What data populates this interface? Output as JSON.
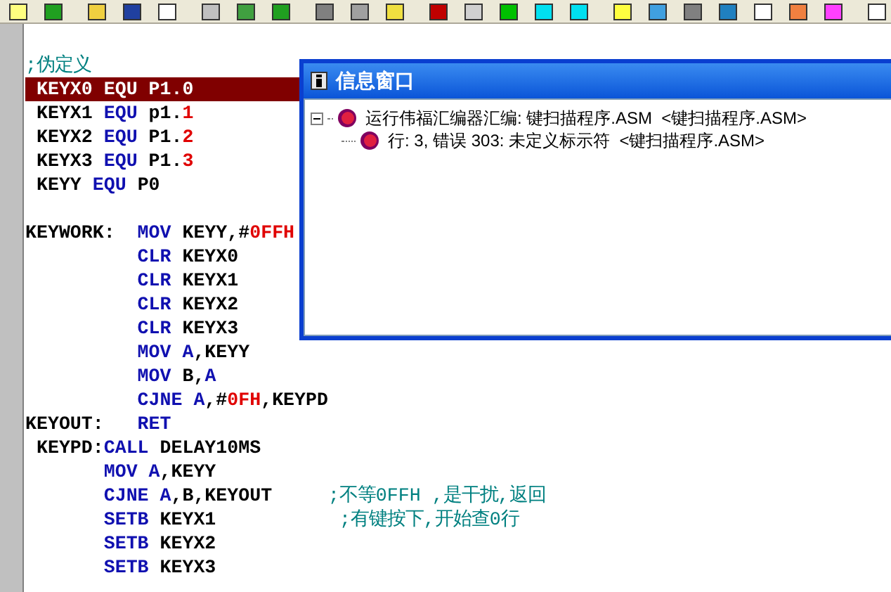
{
  "editor": {
    "lines": [
      {
        "error": false,
        "segments": [
          {
            "kind": "comment",
            "text": ";伪定义"
          }
        ]
      },
      {
        "error": true,
        "segments": [
          {
            "kind": "plain",
            "text": " KEYX0 EQU P1.0"
          }
        ]
      },
      {
        "error": false,
        "segments": [
          {
            "kind": "plain",
            "text": " KEYX1 "
          },
          {
            "kind": "keyword",
            "text": "EQU"
          },
          {
            "kind": "plain",
            "text": " p1."
          },
          {
            "kind": "number",
            "text": "1"
          }
        ]
      },
      {
        "error": false,
        "segments": [
          {
            "kind": "plain",
            "text": " KEYX2 "
          },
          {
            "kind": "keyword",
            "text": "EQU"
          },
          {
            "kind": "plain",
            "text": " P1."
          },
          {
            "kind": "number",
            "text": "2"
          }
        ]
      },
      {
        "error": false,
        "segments": [
          {
            "kind": "plain",
            "text": " KEYX3 "
          },
          {
            "kind": "keyword",
            "text": "EQU"
          },
          {
            "kind": "plain",
            "text": " P1."
          },
          {
            "kind": "number",
            "text": "3"
          }
        ]
      },
      {
        "error": false,
        "segments": [
          {
            "kind": "plain",
            "text": " KEYY "
          },
          {
            "kind": "keyword",
            "text": "EQU"
          },
          {
            "kind": "plain",
            "text": " P0"
          }
        ]
      },
      {
        "error": false
      },
      {
        "error": false,
        "segments": [
          {
            "kind": "plain",
            "text": "KEYWORK:  "
          },
          {
            "kind": "keyword",
            "text": "MOV"
          },
          {
            "kind": "plain",
            "text": " KEYY,#"
          },
          {
            "kind": "number",
            "text": "0FFH"
          }
        ]
      },
      {
        "error": false,
        "segments": [
          {
            "kind": "keyword",
            "text": "          CLR"
          },
          {
            "kind": "plain",
            "text": " KEYX0"
          }
        ]
      },
      {
        "error": false,
        "segments": [
          {
            "kind": "keyword",
            "text": "          CLR"
          },
          {
            "kind": "plain",
            "text": " KEYX1"
          }
        ]
      },
      {
        "error": false,
        "segments": [
          {
            "kind": "keyword",
            "text": "          CLR"
          },
          {
            "kind": "plain",
            "text": " KEYX2"
          }
        ]
      },
      {
        "error": false,
        "segments": [
          {
            "kind": "keyword",
            "text": "          CLR"
          },
          {
            "kind": "plain",
            "text": " KEYX3"
          }
        ]
      },
      {
        "error": false,
        "segments": [
          {
            "kind": "keyword",
            "text": "          MOV A"
          },
          {
            "kind": "plain",
            "text": ",KEYY"
          }
        ]
      },
      {
        "error": false,
        "segments": [
          {
            "kind": "keyword",
            "text": "          MOV"
          },
          {
            "kind": "plain",
            "text": " B,"
          },
          {
            "kind": "keyword",
            "text": "A"
          }
        ]
      },
      {
        "error": false,
        "segments": [
          {
            "kind": "keyword",
            "text": "          CJNE A"
          },
          {
            "kind": "plain",
            "text": ",#"
          },
          {
            "kind": "number",
            "text": "0FH"
          },
          {
            "kind": "plain",
            "text": ",KEYPD"
          }
        ]
      },
      {
        "error": false,
        "segments": [
          {
            "kind": "plain",
            "text": "KEYOUT:   "
          },
          {
            "kind": "keyword",
            "text": "RET"
          }
        ]
      },
      {
        "error": false,
        "segments": [
          {
            "kind": "plain",
            "text": " KEYPD:"
          },
          {
            "kind": "keyword",
            "text": "CALL"
          },
          {
            "kind": "plain",
            "text": " DELAY10MS"
          }
        ]
      },
      {
        "error": false,
        "segments": [
          {
            "kind": "keyword",
            "text": "       MOV A"
          },
          {
            "kind": "plain",
            "text": ",KEYY"
          }
        ]
      },
      {
        "error": false,
        "segments": [
          {
            "kind": "keyword",
            "text": "       CJNE A"
          },
          {
            "kind": "plain",
            "text": ",B,KEYOUT     "
          },
          {
            "kind": "comment",
            "text": ";不等0FFH ,是干扰,返回"
          }
        ]
      },
      {
        "error": false,
        "segments": [
          {
            "kind": "keyword",
            "text": "       SETB"
          },
          {
            "kind": "plain",
            "text": " KEYX1           "
          },
          {
            "kind": "comment",
            "text": ";有键按下,开始查0行"
          }
        ]
      },
      {
        "error": false,
        "segments": [
          {
            "kind": "keyword",
            "text": "       SETB"
          },
          {
            "kind": "plain",
            "text": " KEYX2"
          }
        ]
      },
      {
        "error": false,
        "segments": [
          {
            "kind": "keyword",
            "text": "       SETB"
          },
          {
            "kind": "plain",
            "text": " KEYX3"
          }
        ]
      }
    ]
  },
  "info_window": {
    "title": "信息窗口",
    "tree": [
      {
        "text": "运行伟福汇编器汇编: 键扫描程序.ASM  <键扫描程序.ASM>",
        "expanded": true,
        "children": [
          {
            "text": "行: 3, 错误 303: 未定义标示符  <键扫描程序.ASM>"
          }
        ]
      }
    ]
  }
}
